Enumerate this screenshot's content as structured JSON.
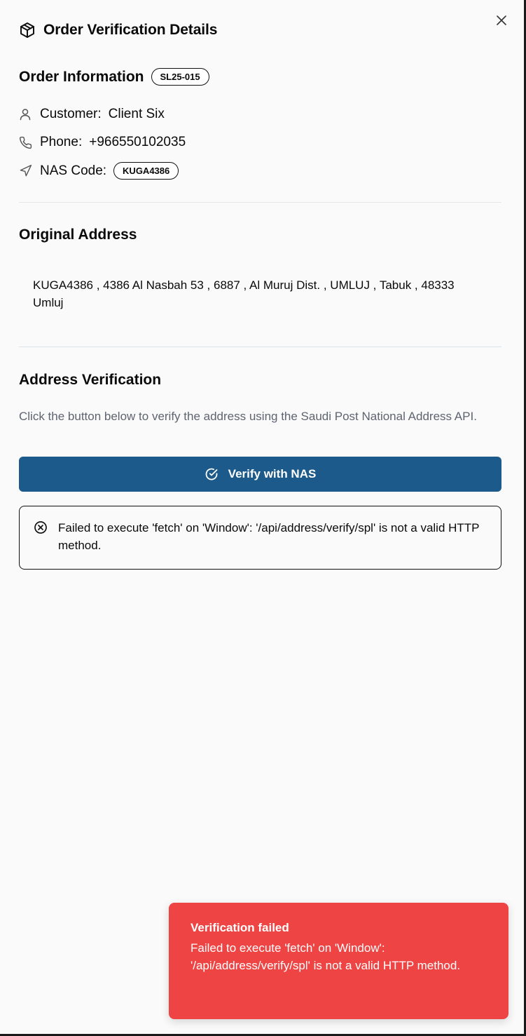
{
  "header": {
    "title": "Order Verification Details",
    "icon": "package-icon",
    "close_icon": "close-icon"
  },
  "order_info": {
    "title": "Order Information",
    "order_id": "SL25-015",
    "customer_label": "Customer:",
    "customer_value": "Client Six",
    "phone_label": "Phone:",
    "phone_value": "+966550102035",
    "nas_label": "NAS Code:",
    "nas_value": "KUGA4386"
  },
  "original_address": {
    "title": "Original Address",
    "text": "KUGA4386 , 4386 Al Nasbah 53 , 6887 , Al Muruj Dist. , UMLUJ , Tabuk , 48333 Umluj"
  },
  "verification": {
    "title": "Address Verification",
    "description": "Click the button below to verify the address using the Saudi Post National Address API.",
    "button_label": "Verify with NAS",
    "error_message": "Failed to execute 'fetch' on 'Window': '/api/address/verify/spl' is not a valid HTTP method."
  },
  "toast": {
    "title": "Verification failed",
    "message": "Failed to execute 'fetch' on 'Window': '/api/address/verify/spl' is not a valid HTTP method."
  },
  "colors": {
    "primary": "#1b5a8a",
    "danger": "#ef4444",
    "background": "#fafafa",
    "muted_text": "#5e6470"
  }
}
